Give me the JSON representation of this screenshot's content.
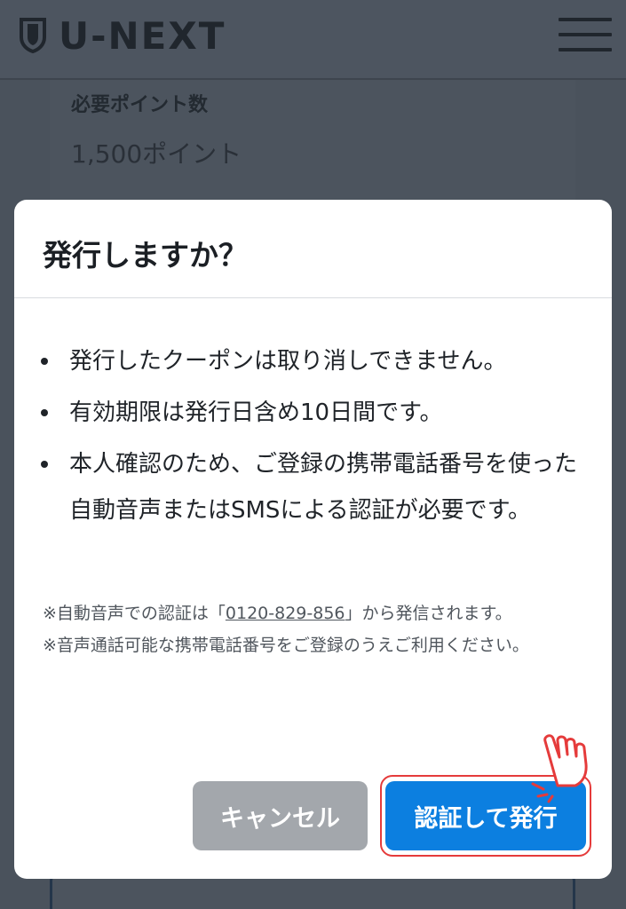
{
  "header": {
    "brand": "U-NEXT",
    "icons": {
      "logo": "shield-logo-icon",
      "menu": "hamburger-menu-icon"
    }
  },
  "background_page": {
    "label": "必要ポイント数",
    "value": "1,500ポイント"
  },
  "dialog": {
    "title": "発行しますか？",
    "bullets": [
      "発行したクーポンは取り消しできません。",
      "有効期限は発行日含め10日間です。",
      "本人確認のため、ご登録の携帯電話番号を使った自動音声またはSMSによる認証が必要です。"
    ],
    "note1_prefix": "※自動音声での認証は「",
    "note1_phone": "0120-829-856",
    "note1_suffix": "」から発信されます。",
    "note2": "※音声通話可能な携帯電話番号をご登録のうえご利用ください。",
    "cancel_label": "キャンセル",
    "confirm_label": "認証して発行"
  },
  "colors": {
    "primary": "#0c7fe0",
    "cancel": "#a3a7ac",
    "highlight": "#e53b3b",
    "overlay": "#4a525c"
  }
}
